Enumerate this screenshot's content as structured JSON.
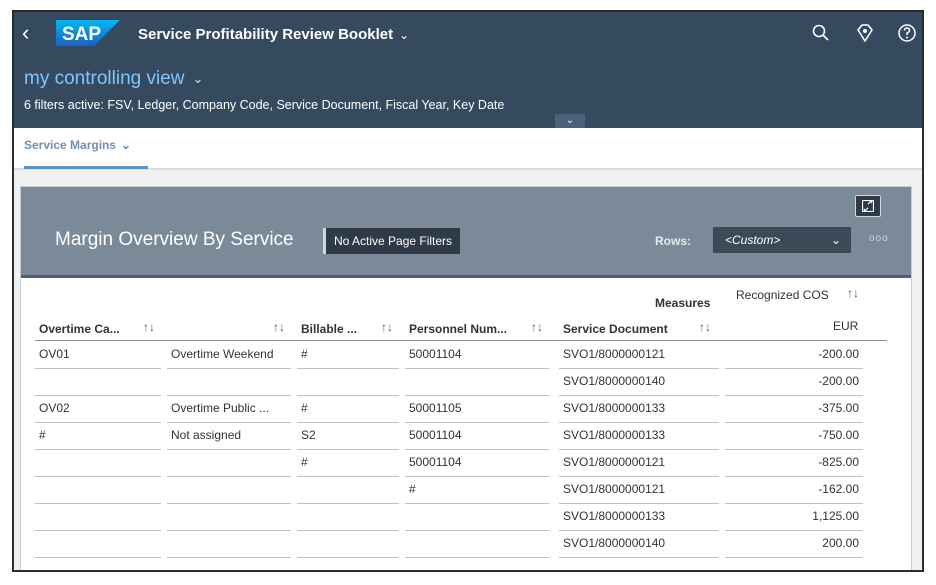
{
  "shell": {
    "back_glyph": "‹",
    "logo_text": "SAP",
    "title": "Service Profitability Review Booklet",
    "icons": [
      "search-icon",
      "feedback-icon",
      "help-icon"
    ]
  },
  "header": {
    "view_name": "my controlling view",
    "filters_text": "6 filters active: FSV, Ledger, Company Code, Service Document, Fiscal Year, Key Date"
  },
  "tabs": [
    {
      "label": "Service Margins"
    }
  ],
  "card": {
    "title": "Margin Overview By Service",
    "page_filter_badge": "No Active Page Filters",
    "rows_label": "Rows:",
    "rows_value": "<Custom>",
    "more_glyph": "ooo"
  },
  "table": {
    "measures_label": "Measures",
    "measure_name": "Recognized COS",
    "currency": "EUR",
    "columns": [
      "Overtime Ca...",
      "",
      "Billable ...",
      "Personnel Num...",
      "Service Document"
    ],
    "rows": [
      [
        "OV01",
        "Overtime Weekend",
        "#",
        "50001104",
        "SVO1/8000000121",
        "-200.00"
      ],
      [
        "",
        "",
        "",
        "",
        "SVO1/8000000140",
        "-200.00"
      ],
      [
        "OV02",
        "Overtime Public ...",
        "#",
        "50001105",
        "SVO1/8000000133",
        "-375.00"
      ],
      [
        "#",
        "Not assigned",
        "S2",
        "50001104",
        "SVO1/8000000133",
        "-750.00"
      ],
      [
        "",
        "",
        "#",
        "50001104",
        "SVO1/8000000121",
        "-825.00"
      ],
      [
        "",
        "",
        "",
        "#",
        "SVO1/8000000121",
        "-162.00"
      ],
      [
        "",
        "",
        "",
        "",
        "SVO1/8000000133",
        "1,125.00"
      ],
      [
        "",
        "",
        "",
        "",
        "SVO1/8000000140",
        "200.00"
      ]
    ]
  },
  "colors": {
    "shell": "#354a5f",
    "view_link": "#7fc6ff",
    "card_header": "#7b8a99"
  }
}
